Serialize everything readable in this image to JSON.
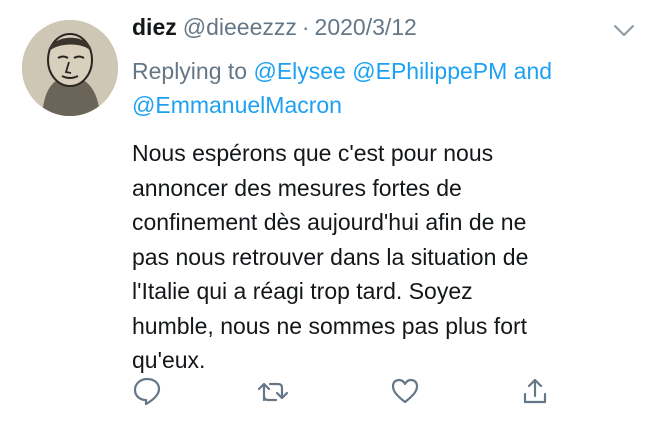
{
  "tweet": {
    "author_name": "diez",
    "author_handle": "@dieeezzz",
    "separator": "·",
    "date": "2020/3/12",
    "reply_prefix": "Replying to",
    "mentions": [
      "@Elysee",
      "@EPhilippePM",
      "@EmmanuelMacron"
    ],
    "mention_joiner": "and",
    "text": "Nous espérons que c'est pour nous\nannoncer des mesures fortes de\nconfinement dès aujourd'hui afin de ne\npas nous retrouver dans la situation de\nl'Italie qui a réagi trop tard. Soyez\nhumble, nous ne sommes pas plus fort\nqu'eux."
  },
  "icons": {
    "caret": "chevron-down-icon",
    "reply": "reply-icon",
    "retweet": "retweet-icon",
    "like": "heart-icon",
    "share": "share-icon"
  },
  "colors": {
    "text": "#14171a",
    "secondary": "#657786",
    "mention": "#1da1f2",
    "icon": "#657786"
  }
}
